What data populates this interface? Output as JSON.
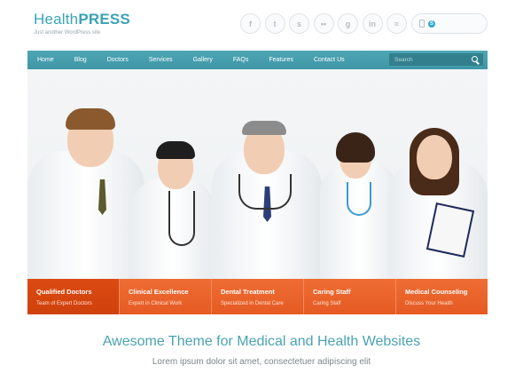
{
  "logo": {
    "title_light": "Health",
    "title_bold": "PRESS",
    "tagline": "Just another WordPress site"
  },
  "social": [
    {
      "icon": "facebook-icon",
      "glyph": "f"
    },
    {
      "icon": "twitter-icon",
      "glyph": "t"
    },
    {
      "icon": "skype-icon",
      "glyph": "s"
    },
    {
      "icon": "flickr-icon",
      "glyph": "••"
    },
    {
      "icon": "google-icon",
      "glyph": "g"
    },
    {
      "icon": "linkedin-icon",
      "glyph": "in"
    },
    {
      "icon": "rss-icon",
      "glyph": "≈"
    }
  ],
  "nav": {
    "items": [
      "Home",
      "Blog",
      "Doctors",
      "Services",
      "Gallery",
      "FAQs",
      "Features",
      "Contact Us"
    ],
    "search_placeholder": "Search"
  },
  "features": [
    {
      "title": "Qualified Doctors",
      "subtitle": "Team of Expert Doctors"
    },
    {
      "title": "Clinical Excellence",
      "subtitle": "Expert in Clinical Work"
    },
    {
      "title": "Dental Treatment",
      "subtitle": "Specialized in Dental Care"
    },
    {
      "title": "Caring Staff",
      "subtitle": "Caring Staff"
    },
    {
      "title": "Medical Counseling",
      "subtitle": "Discuss Your Health"
    }
  ],
  "headline": "Awesome Theme for Medical and Health Websites",
  "subline": "Lorem ipsum dolor sit amet, consectetuer adipiscing elit",
  "colors": {
    "accent": "#3aa3b4",
    "orange": "#e95f27",
    "orange_active": "#d4450f"
  }
}
